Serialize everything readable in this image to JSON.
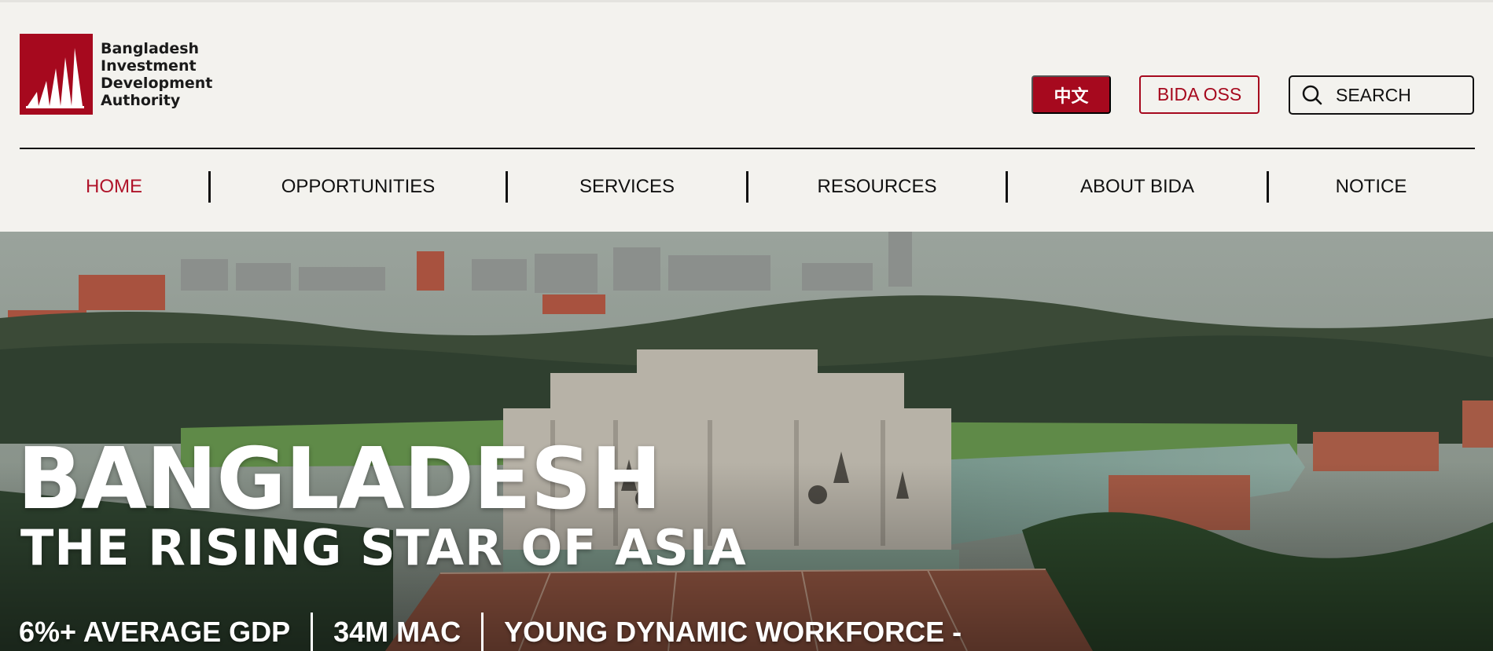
{
  "logo": {
    "lines": [
      "Bangladesh",
      "Investment",
      "Development",
      "Authority"
    ]
  },
  "header": {
    "language_button": "中文",
    "oss_button": "BIDA OSS",
    "search_placeholder": "SEARCH"
  },
  "nav": {
    "items": [
      {
        "label": "HOME",
        "active": true
      },
      {
        "label": "OPPORTUNITIES",
        "active": false
      },
      {
        "label": "SERVICES",
        "active": false
      },
      {
        "label": "RESOURCES",
        "active": false
      },
      {
        "label": "ABOUT BIDA",
        "active": false
      },
      {
        "label": "NOTICE",
        "active": false
      }
    ]
  },
  "hero": {
    "title": "BANGLADESH",
    "subtitle": "THE RISING STAR OF ASIA",
    "stats": [
      "6%+ AVERAGE GDP",
      "34M MAC",
      "YOUNG DYNAMIC WORKFORCE -"
    ]
  },
  "colors": {
    "brand": "#a6091e",
    "background": "#f3f2ee",
    "text": "#111111"
  }
}
